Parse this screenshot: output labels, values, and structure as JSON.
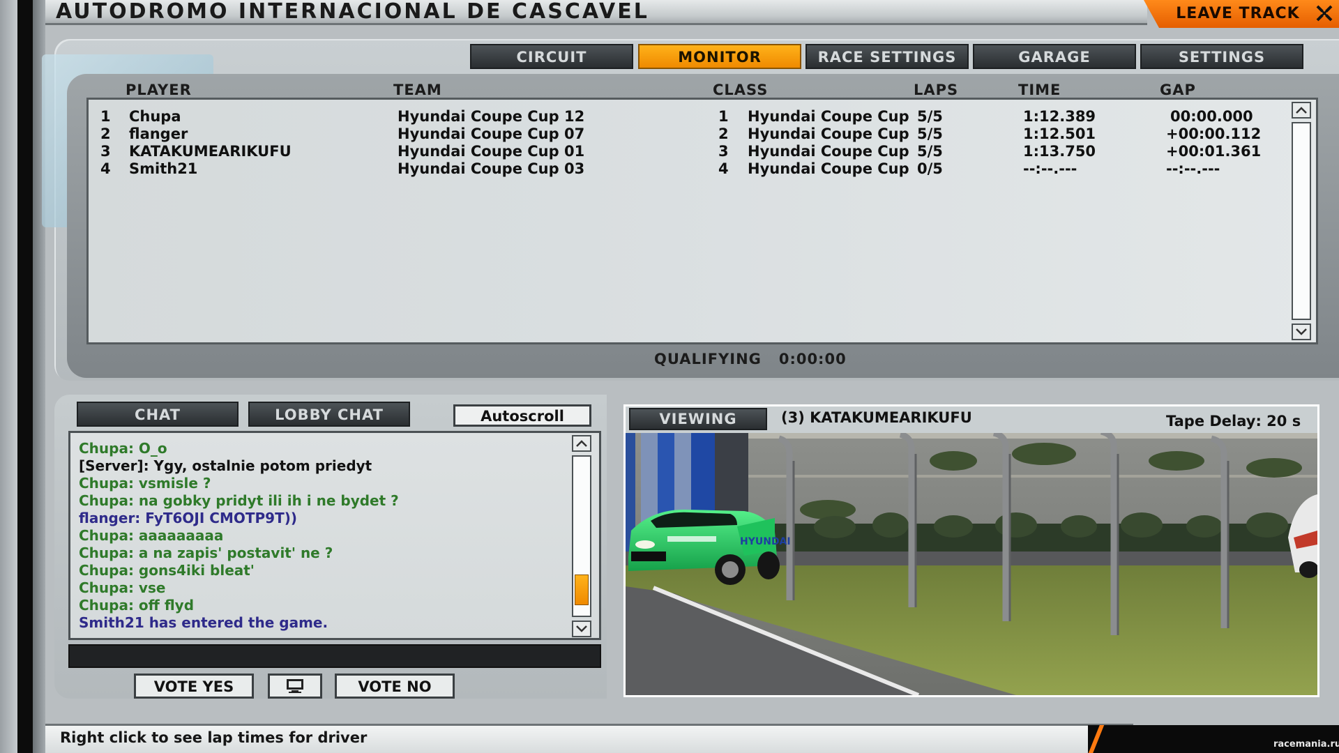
{
  "header": {
    "track_name": "AUTODROMO INTERNACIONAL DE CASCAVEL",
    "leave_label": "LEAVE TRACK"
  },
  "tabs": [
    {
      "label": "CIRCUIT",
      "active": false
    },
    {
      "label": "MONITOR",
      "active": true
    },
    {
      "label": "RACE SETTINGS",
      "active": false
    },
    {
      "label": "GARAGE",
      "active": false
    },
    {
      "label": "SETTINGS",
      "active": false
    }
  ],
  "results": {
    "columns": {
      "player": "PLAYER",
      "team": "TEAM",
      "class": "CLASS",
      "laps": "LAPS",
      "time": "TIME",
      "gap": "GAP"
    },
    "rows": [
      {
        "pos": "1",
        "player": "Chupa",
        "team": "Hyundai Coupe Cup 12",
        "class_pos": "1",
        "class": "Hyundai Coupe Cup",
        "laps": "5/5",
        "time": "1:12.389",
        "gap": "00:00.000"
      },
      {
        "pos": "2",
        "player": "flanger",
        "team": "Hyundai Coupe Cup 07",
        "class_pos": "2",
        "class": "Hyundai Coupe Cup",
        "laps": "5/5",
        "time": "1:12.501",
        "gap": "+00:00.112"
      },
      {
        "pos": "3",
        "player": "KATAKUMEARIKUFU",
        "team": "Hyundai Coupe Cup 01",
        "class_pos": "3",
        "class": "Hyundai Coupe Cup",
        "laps": "5/5",
        "time": "1:13.750",
        "gap": "+00:01.361"
      },
      {
        "pos": "4",
        "player": "Smith21",
        "team": "Hyundai Coupe Cup 03",
        "class_pos": "4",
        "class": "Hyundai Coupe Cup",
        "laps": "0/5",
        "time": "--:--.---",
        "gap": "--:--.---"
      }
    ]
  },
  "session": {
    "label": "QUALIFYING",
    "time": "0:00:00"
  },
  "chat": {
    "tabs": [
      "CHAT",
      "LOBBY CHAT"
    ],
    "autoscroll_label": "Autoscroll",
    "input_value": "",
    "lines": [
      {
        "text": "Chupa: O_o",
        "color": "#2f7a2a"
      },
      {
        "text": "[Server]: Ygy, ostalnie potom priedyt",
        "color": "#111111"
      },
      {
        "text": "Chupa: vsmisle ?",
        "color": "#2f7a2a"
      },
      {
        "text": "Chupa: na gobky pridyt ili ih i ne bydet ?",
        "color": "#2f7a2a"
      },
      {
        "text": "flanger: FyT6OJI CMOTP9T))",
        "color": "#2e2a8a"
      },
      {
        "text": "Chupa: aaaaaaaaa",
        "color": "#2f7a2a"
      },
      {
        "text": "Chupa: a na zapis' postavit' ne ?",
        "color": "#2f7a2a"
      },
      {
        "text": "Chupa: gons4iki bleat'",
        "color": "#2f7a2a"
      },
      {
        "text": "Chupa: vse",
        "color": "#2f7a2a"
      },
      {
        "text": "Chupa: off flyd",
        "color": "#2f7a2a"
      },
      {
        "text": "Smith21 has entered the game.",
        "color": "#2e2a8a"
      }
    ],
    "scroll_position": 0.92
  },
  "vote": {
    "yes_label": "VOTE YES",
    "no_label": "VOTE NO"
  },
  "viewer": {
    "label": "VIEWING",
    "driver": "(3) KATAKUMEARIKUFU",
    "tape_delay": "Tape Delay: 20 s"
  },
  "status_bar": {
    "help": "Right click to see lap times for driver"
  },
  "watermark": "racemania.ru",
  "colors": {
    "accent": "#ff8c00",
    "tab_dark": "#2f3336",
    "panel": "#c4cacc"
  },
  "icons": {
    "close": "close-icon",
    "scroll_up": "chevron-up-icon",
    "scroll_down": "chevron-down-icon",
    "monitor": "monitor-icon"
  }
}
